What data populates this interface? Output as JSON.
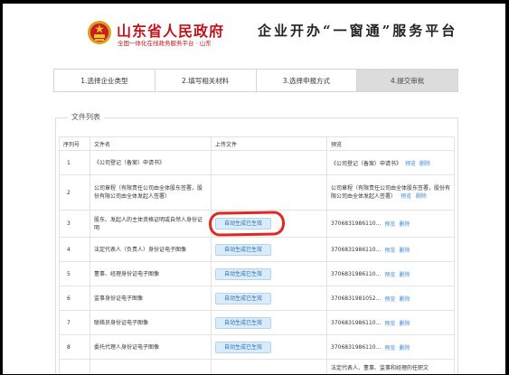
{
  "header": {
    "logo_main": "山东省人民政府",
    "logo_sub": "全国一体化在线政务服务平台 · 山东",
    "slogan": "企业开办“一窗通”服务平台"
  },
  "tabs": [
    {
      "label": "1.选择企业类型",
      "active": false
    },
    {
      "label": "2.填写相关材料",
      "active": false
    },
    {
      "label": "3.选择申报方式",
      "active": false
    },
    {
      "label": "4.提交审批",
      "active": true
    }
  ],
  "file_list": {
    "legend": "文件列表",
    "columns": {
      "no": "序列号",
      "name": "文件名",
      "upload": "上传文件",
      "preview": "预览"
    },
    "rows": [
      {
        "no": "1",
        "name": "《公司登记（备案）申请书》",
        "upload": "",
        "preview_text": "《公司登记（备案）申请书》",
        "preview_link": "预览",
        "delete_link": "删除"
      },
      {
        "no": "2",
        "name": "公司章程（有限责任公司由全体股东签署，股份有限公司由全体发起人签署）",
        "upload": "",
        "preview_text": "公司章程（有限责任公司由全体股东签署，股份有限公司由全体发起人签署）",
        "preview_link": "预览",
        "delete_link": "删除"
      },
      {
        "no": "3",
        "name": "股东、发起人的主体资格证明或自然人身份证明",
        "upload": "自动生成已生效",
        "preview_text": "3706831986110...",
        "preview_link": "预览",
        "delete_link": "删除"
      },
      {
        "no": "4",
        "name": "法定代表人（负责人）身份证电子图像",
        "upload": "自动生成已生效",
        "preview_text": "3706831986110...",
        "preview_link": "预览",
        "delete_link": "删除"
      },
      {
        "no": "5",
        "name": "董事、经理身份证电子图像",
        "upload": "自动生成已生效",
        "preview_text": "3706831986110...",
        "preview_link": "预览",
        "delete_link": "删除"
      },
      {
        "no": "6",
        "name": "监事身份证电子图像",
        "upload": "自动生成已生效",
        "preview_text": "3706831981052...",
        "preview_link": "预览",
        "delete_link": "删除"
      },
      {
        "no": "7",
        "name": "联络员身份证电子图像",
        "upload": "自动生成已生效",
        "preview_text": "3706831986110...",
        "preview_link": "预览",
        "delete_link": "删除"
      },
      {
        "no": "8",
        "name": "委托代理人身份证电子图像",
        "upload": "自动生成已生效",
        "preview_text": "3706831986110...",
        "preview_link": "预览",
        "delete_link": "删除"
      },
      {
        "no": "",
        "name": "",
        "upload": "",
        "preview_text": "法定代表人、董事、监事和经理的任职文",
        "preview_link": "",
        "delete_link": ""
      }
    ]
  },
  "colors": {
    "brand_red": "#c0141b",
    "link_blue": "#3f8cd6",
    "button_bg": "#d9ecfb",
    "annotation_red": "#e2271f"
  },
  "icons": {
    "emblem": "national-emblem-icon"
  }
}
